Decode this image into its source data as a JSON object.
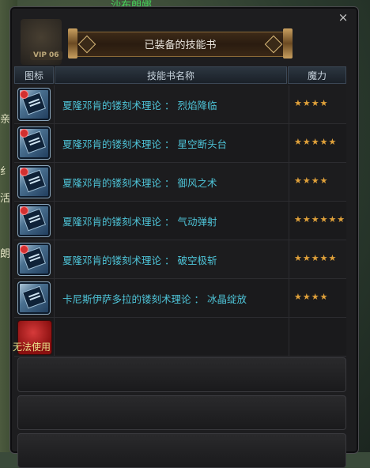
{
  "background": {
    "top_text": "沙布朗娜",
    "left_chars": [
      "活",
      "朗",
      "纟",
      "亲"
    ]
  },
  "window": {
    "vip_label": "VIP 06",
    "title": "已装备的技能书",
    "close_symbol": "×"
  },
  "table": {
    "headers": {
      "icon": "图标",
      "name": "技能书名称",
      "mana": "魔力"
    },
    "rows": [
      {
        "name": "夏隆邓肯的镂刻术理论 ： 烈焰降临",
        "mana": "★★★★"
      },
      {
        "name": "夏隆邓肯的镂刻术理论 ： 星空断头台",
        "mana": "★★★★★"
      },
      {
        "name": "夏隆邓肯的镂刻术理论 ： 御风之术",
        "mana": "★★★★"
      },
      {
        "name": "夏隆邓肯的镂刻术理论 ： 气动弹射",
        "mana": "★★★★★★"
      },
      {
        "name": "夏隆邓肯的镂刻术理论 ： 破空极斩",
        "mana": "★★★★★"
      },
      {
        "name": "卡尼斯伊萨多拉的镂刻术理论 ： 冰晶绽放",
        "mana": "★★★★"
      }
    ],
    "locked_slot_label": "无法使用"
  },
  "colors": {
    "name_text": "#4ec4d8",
    "star": "#e0a13a",
    "locked_text": "#e8e08a",
    "panel_bg": "#1d1d1f"
  },
  "icons": {
    "skill_book": "skill-book-icon",
    "lock": "lock-icon",
    "close": "close-icon",
    "locked_slot": "red-slot-icon"
  }
}
